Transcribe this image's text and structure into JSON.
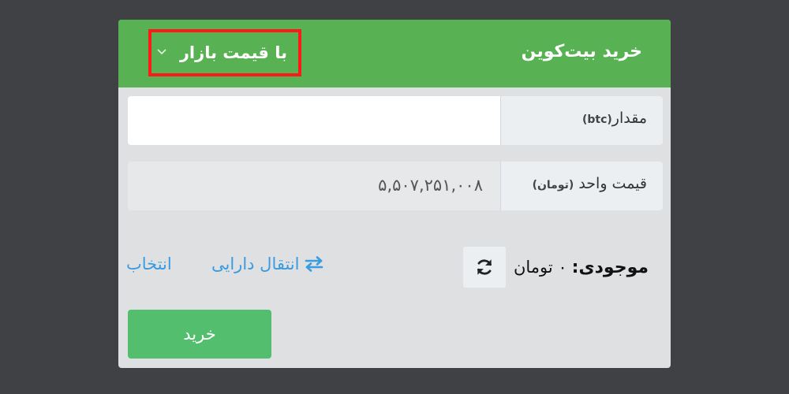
{
  "header": {
    "title": "خرید بیت‌کوین",
    "order_type": "با قیمت بازار"
  },
  "amount_row": {
    "label": "مقدار",
    "unit": "(btc)",
    "value": "",
    "placeholder": ""
  },
  "price_row": {
    "label": "قیمت واحد",
    "unit": "(تومان)",
    "value": "۵,۵۰۷,۲۵۱,۰۰۸"
  },
  "balance": {
    "label": "موجودی:",
    "value": "۰ تومان"
  },
  "actions": {
    "transfer_label": "انتقال دارایی",
    "select_label": "انتخاب",
    "buy_label": "خرید"
  },
  "colors": {
    "header_green": "#58b152",
    "buy_button_green": "#52be6e",
    "link_blue": "#3a9be0",
    "highlight_red": "#ff1a1a"
  },
  "icons": {
    "dropdown": "chevron-down-icon",
    "refresh": "refresh-icon",
    "transfer": "swap-arrows-icon"
  }
}
